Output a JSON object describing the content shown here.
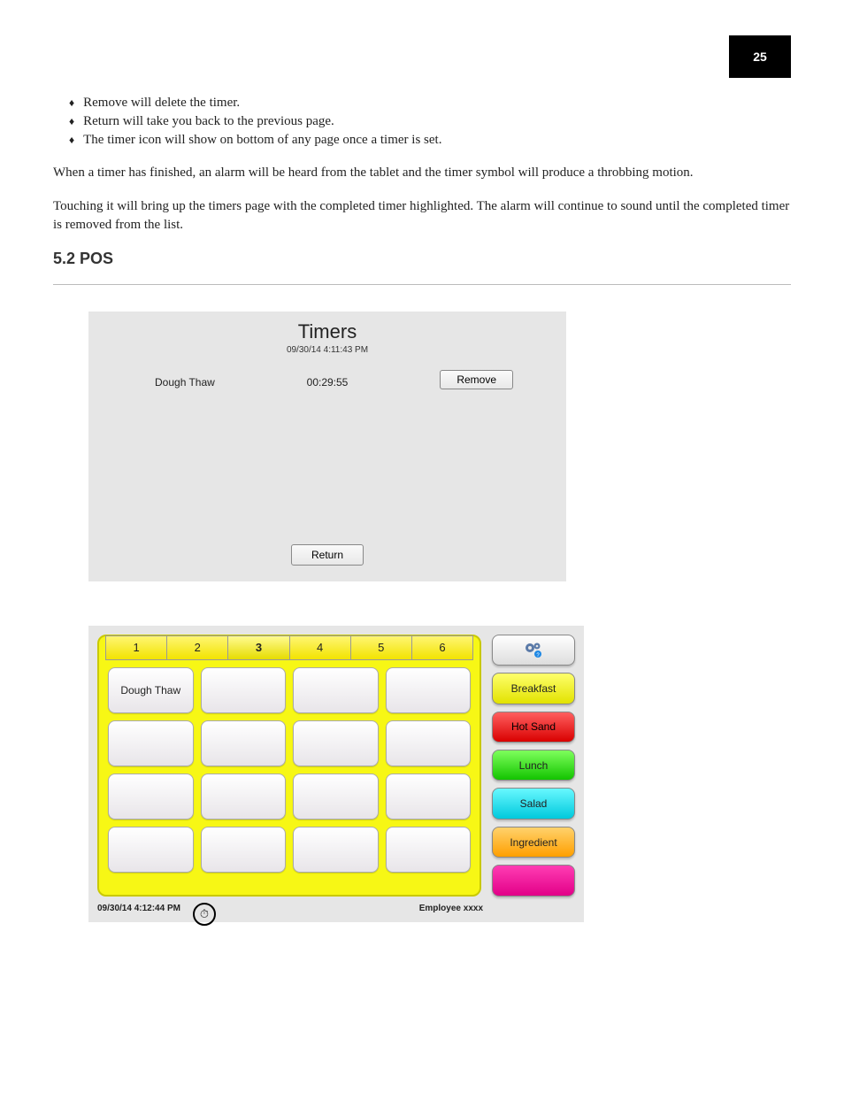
{
  "page_badge": "25",
  "bullets": [
    "Remove will delete the timer.",
    "Return will take you back to the previous page.",
    "The timer icon will show on bottom of any page once a timer is set."
  ],
  "paragraphs": [
    "When a timer has finished, an alarm will be heard from the tablet and the timer symbol will produce a throbbing motion.",
    "Touching it will bring up the timers page with the completed timer highlighted. The alarm will continue to sound until the completed timer is removed from the list."
  ],
  "section_title": "5.2 POS",
  "ss1": {
    "title": "Timers",
    "datetime": "09/30/14  4:11:43 PM",
    "item_name": "Dough Thaw",
    "item_time": "00:29:55",
    "remove_label": "Remove",
    "return_label": "Return"
  },
  "ss2": {
    "tabs": [
      "1",
      "2",
      "3",
      "4",
      "5",
      "6"
    ],
    "active_tab_index": 2,
    "cell_label": "Dough Thaw",
    "side": {
      "breakfast": "Breakfast",
      "hotsand": "Hot Sand",
      "lunch": "Lunch",
      "salad": "Salad",
      "ingredient": "Ingredient"
    },
    "footer_datetime": "09/30/14  4:12:44 PM",
    "footer_employee": "Employee xxxx",
    "stopwatch_glyph": "⏱"
  }
}
